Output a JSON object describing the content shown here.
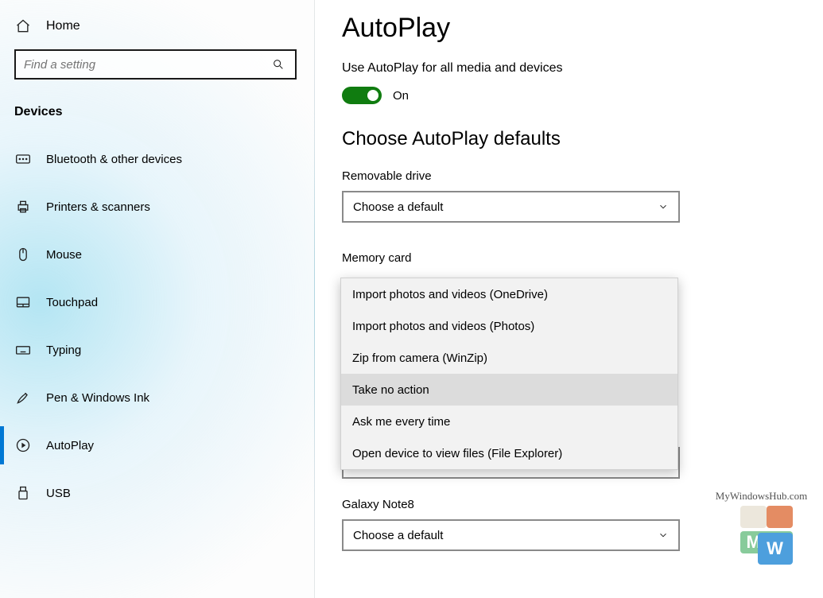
{
  "sidebar": {
    "home_label": "Home",
    "search_placeholder": "Find a setting",
    "section_title": "Devices",
    "items": [
      {
        "id": "bluetooth",
        "label": "Bluetooth & other devices"
      },
      {
        "id": "printers",
        "label": "Printers & scanners"
      },
      {
        "id": "mouse",
        "label": "Mouse"
      },
      {
        "id": "touchpad",
        "label": "Touchpad"
      },
      {
        "id": "typing",
        "label": "Typing"
      },
      {
        "id": "pen",
        "label": "Pen & Windows Ink"
      },
      {
        "id": "autoplay",
        "label": "AutoPlay"
      },
      {
        "id": "usb",
        "label": "USB"
      }
    ],
    "active_id": "autoplay"
  },
  "main": {
    "title": "AutoPlay",
    "toggle_heading": "Use AutoPlay for all media and devices",
    "toggle_state_label": "On",
    "toggle_on": true,
    "defaults_heading": "Choose AutoPlay defaults",
    "fields": [
      {
        "id": "removable",
        "label": "Removable drive",
        "value": "Choose a default"
      },
      {
        "id": "memcard",
        "label": "Memory card",
        "value": "Open device to view files (File Explorer)"
      },
      {
        "id": "note8",
        "label": "Galaxy Note8",
        "value": "Choose a default"
      }
    ],
    "dropdown_options": [
      "Import photos and videos (OneDrive)",
      "Import photos and videos (Photos)",
      "Zip from camera (WinZip)",
      "Take no action",
      "Ask me every time",
      "Open device to view files (File Explorer)"
    ],
    "dropdown_highlight_index": 3
  },
  "watermark": {
    "text": "MyWindowsHub.com",
    "glyph1": "M",
    "glyph2": "W"
  }
}
